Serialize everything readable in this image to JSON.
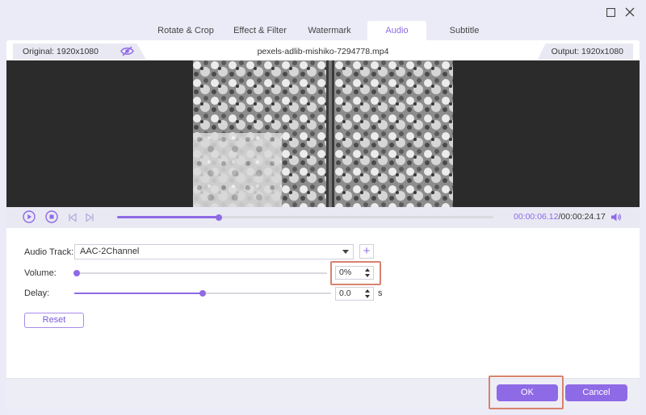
{
  "window": {
    "maximize_icon": "maximize-icon",
    "close_icon": "close-icon"
  },
  "tabs": [
    {
      "label": "Rotate & Crop",
      "active": false
    },
    {
      "label": "Effect & Filter",
      "active": false
    },
    {
      "label": "Watermark",
      "active": false
    },
    {
      "label": "Audio",
      "active": true
    },
    {
      "label": "Subtitle",
      "active": false
    }
  ],
  "info": {
    "original": "Original: 1920x1080",
    "filename": "pexels-adlib-mishiko-7294778.mp4",
    "output": "Output: 1920x1080",
    "eye_icon": "eye-icon"
  },
  "player": {
    "current_time": "00:00:06.12",
    "separator": "/",
    "total_time": "00:00:24.17",
    "progress_fraction": 0.27,
    "icons": [
      "play-icon",
      "stop-icon",
      "previous-frame-icon",
      "next-frame-icon",
      "volume-icon"
    ]
  },
  "audio": {
    "track_label": "Audio Track:",
    "track_value": "AAC-2Channel",
    "add_button": "+",
    "volume_label": "Volume:",
    "volume_value": "0%",
    "volume_fraction": 0.0,
    "delay_label": "Delay:",
    "delay_value": "0.0",
    "delay_unit": "s",
    "delay_fraction": 0.5,
    "reset_label": "Reset"
  },
  "footer": {
    "ok_label": "OK",
    "cancel_label": "Cancel"
  },
  "colors": {
    "accent": "#8e6ae6",
    "highlight": "#d8826f",
    "video_bg": "#2b2b2b"
  }
}
